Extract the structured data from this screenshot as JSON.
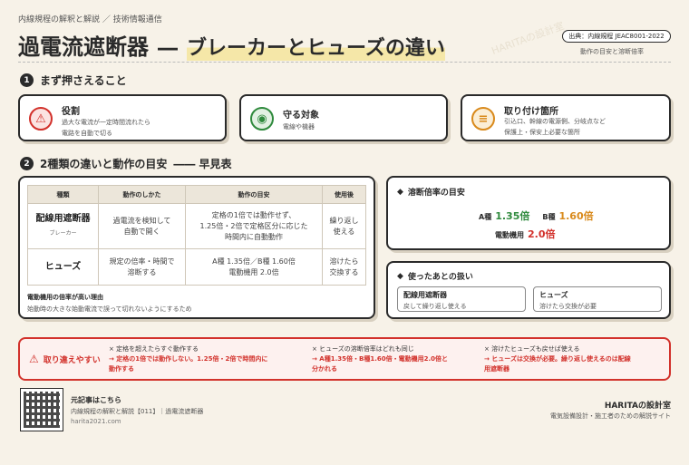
{
  "header": {
    "kicker": "内線規程の解釈と解説 ／ 技術情報通信",
    "title_main": "過電流遮断器",
    "title_dash": "―",
    "title_sub": "ブレーカーとヒューズの違い",
    "source": "出典：内線規程 JEAC8001-2022",
    "source_note": "動作の目安と溶断倍率",
    "watermark": "HARITAの設計室"
  },
  "section1": {
    "num": "1",
    "title": "まず押さえること",
    "cards": [
      {
        "icon": "warning-icon",
        "title": "役割",
        "text": "過大な電流が一定時間流れたら\n電路を自動で切る"
      },
      {
        "icon": "target-icon",
        "title": "守る対象",
        "text": "電線や機器"
      },
      {
        "icon": "location-icon",
        "title": "取り付け箇所",
        "text": "引込口、幹線の電源側、分岐点など\n保護上・保安上必要な箇所"
      }
    ]
  },
  "section2": {
    "num": "2",
    "title": "2種類の違いと動作の目安",
    "title_suffix": "―― 早見表",
    "table": {
      "headers": [
        "種類",
        "動作のしかた",
        "動作の目安",
        "使用後"
      ],
      "rows": [
        {
          "name": "配線用遮断器",
          "sub": "ブレーカー",
          "how": "過電流を検知して\n自動で開く",
          "guide": "定格の1倍では動作せず、\n1.25倍・2倍で定格区分に応じた\n時間内に自動動作",
          "after": "繰り返し\n使える"
        },
        {
          "name": "ヒューズ",
          "sub": "",
          "how": "規定の倍率・時間で\n溶断する",
          "guide": "A種 1.35倍／B種 1.60倍\n電動機用 2.0倍",
          "after": "溶けたら\n交換する"
        }
      ]
    },
    "note_title": "電動機用の倍率が高い理由",
    "note_text": "始動時の大きな始動電流で誤って切れないようにするため"
  },
  "fuse_panel": {
    "title": "溶断倍率の目安",
    "a_label": "A種",
    "a_value": "1.35倍",
    "b_label": "B種",
    "b_value": "1.60倍",
    "m_label": "電動機用",
    "m_value": "2.0倍"
  },
  "after_panel": {
    "title": "使ったあとの扱い",
    "boxes": [
      {
        "title": "配線用遮断器",
        "text": "戻して繰り返し使える"
      },
      {
        "title": "ヒューズ",
        "text": "溶けたら交換が必要"
      }
    ]
  },
  "warning": {
    "label": "取り違えやすい",
    "items": [
      {
        "wrong": "× 定格を超えたらすぐ動作する",
        "right": "→ 定格の1倍では動作しない。1.25倍・2倍で時間内に\n動作する"
      },
      {
        "wrong": "× ヒューズの溶断倍率はどれも同じ",
        "right": "→ A種1.35倍・B種1.60倍・電動機用2.0倍と\n分かれる"
      },
      {
        "wrong": "× 溶けたヒューズも戻せば使える",
        "right": "→ ヒューズは交換が必要。繰り返し使えるのは配線\n用遮断器"
      }
    ]
  },
  "footer": {
    "qr_label": "元記事はこちら",
    "link_text": "内線規程の解釈と解説【011】｜過電流遮断器",
    "url": "harita2021.com",
    "brand": "HARITAの設計室",
    "tagline": "電気設備設計・施工者のための解説サイト"
  },
  "colors": {
    "accent_red": "#d2312b",
    "accent_green": "#2f8a3d",
    "accent_orange": "#d98a1c",
    "highlight": "#f5e7a8"
  }
}
